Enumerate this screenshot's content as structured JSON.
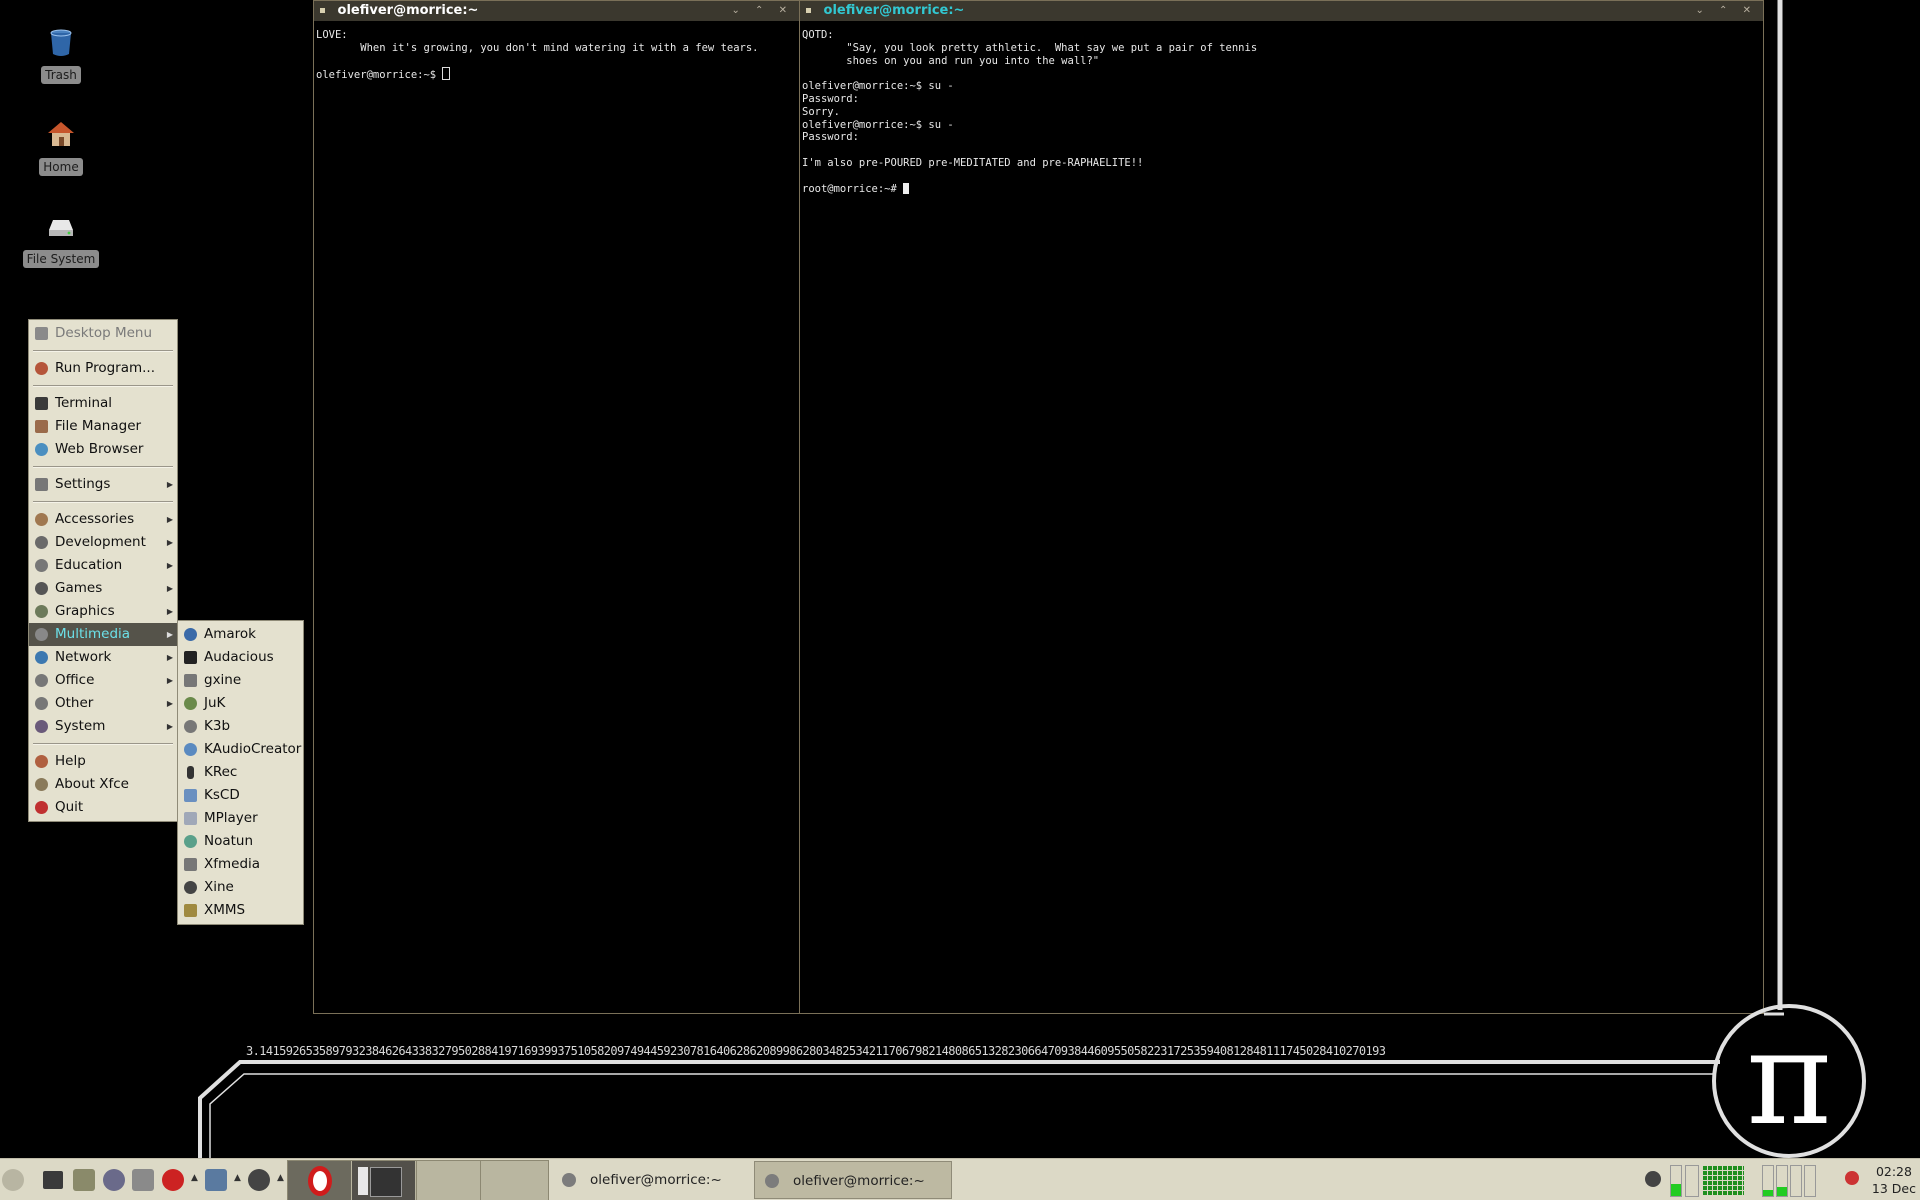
{
  "desktop": {
    "icons": [
      {
        "label": "Trash",
        "icon": "trash-icon"
      },
      {
        "label": "Home",
        "icon": "home-icon"
      },
      {
        "label": "File System",
        "icon": "drive-icon"
      }
    ]
  },
  "terminals": {
    "left": {
      "title": "olefiver@morrice:~",
      "lines": "LOVE:\n       When it's growing, you don't mind watering it with a few tears.\n\nolefiver@morrice:~$ "
    },
    "right": {
      "title": "olefiver@morrice:~",
      "lines": "QOTD:\n       \"Say, you look pretty athletic.  What say we put a pair of tennis\n       shoes on you and run you into the wall?\"\n\nolefiver@morrice:~$ su -\nPassword:\nSorry.\nolefiver@morrice:~$ su -\nPassword:\n\nI'm also pre-POURED pre-MEDITATED and pre-RAPHAELITE!!\n\nroot@morrice:~# "
    }
  },
  "desktop_menu": {
    "header": "Desktop Menu",
    "items": {
      "run_program": "Run Program...",
      "terminal": "Terminal",
      "file_manager": "File Manager",
      "web_browser": "Web Browser",
      "settings": "Settings",
      "accessories": "Accessories",
      "development": "Development",
      "education": "Education",
      "games": "Games",
      "graphics": "Graphics",
      "multimedia": "Multimedia",
      "network": "Network",
      "office": "Office",
      "other": "Other",
      "system": "System",
      "help": "Help",
      "about_xfce": "About Xfce",
      "quit": "Quit"
    },
    "selected": "Multimedia"
  },
  "multimedia_menu": {
    "items": [
      "Amarok",
      "Audacious",
      "gxine",
      "JuK",
      "K3b",
      "KAudioCreator",
      "KRec",
      "KsCD",
      "MPlayer",
      "Noatun",
      "Xfmedia",
      "Xine",
      "XMMS"
    ]
  },
  "pi_digits": "3.14159265358979323846264338327950288419716939937510582097494459230781640628620899862803482534211706798214808651328230664709384460955058223172535940812848111745028410270193",
  "taskbar": {
    "windows": [
      {
        "label": "olefiver@morrice:~",
        "active": false
      },
      {
        "label": "olefiver@morrice:~",
        "active": true
      }
    ],
    "clock_time": "02:28",
    "clock_date": "13 Dec"
  },
  "colors": {
    "menu_bg": "#e4e1cf",
    "menu_selected_bg": "#55534a",
    "menu_selected_fg": "#6ce0e8",
    "titlebar_bg": "#3b382e",
    "active_title_fg": "#32c8d2",
    "taskbar_bg": "#dcd9c6"
  }
}
